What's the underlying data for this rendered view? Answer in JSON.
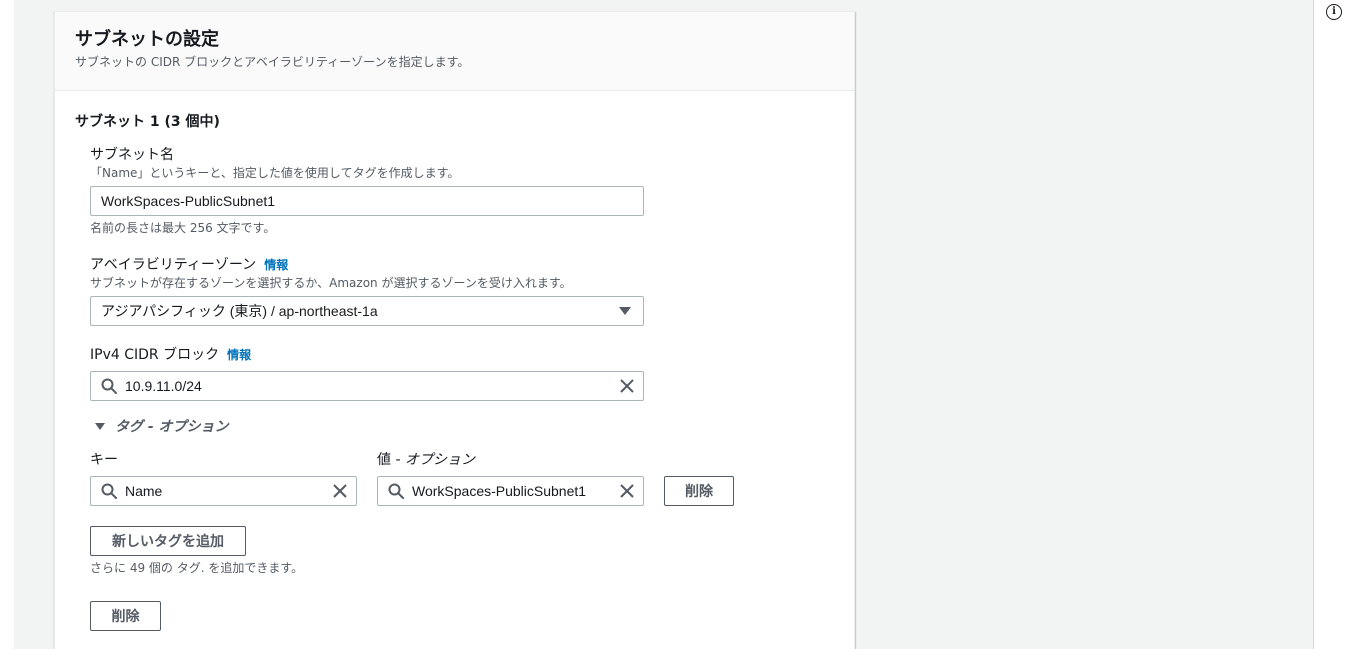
{
  "help_icon": "info-icon",
  "section": {
    "title": "サブネットの設定",
    "description": "サブネットの CIDR ブロックとアベイラビリティーゾーンを指定します。"
  },
  "subnet": {
    "heading": "サブネット 1 (3 個中)",
    "name_field": {
      "label": "サブネット名",
      "description": "「Name」というキーと、指定した値を使用してタグを作成します。",
      "value": "WorkSpaces-PublicSubnet1",
      "constraint": "名前の長さは最大 256 文字です。"
    },
    "az_field": {
      "label": "アベイラビリティーゾーン",
      "info": "情報",
      "description": "サブネットが存在するゾーンを選択するか、Amazon が選択するゾーンを受け入れます。",
      "selected": "アジアパシフィック (東京) / ap-northeast-1a"
    },
    "cidr_field": {
      "label": "IPv4 CIDR ブロック",
      "info": "情報",
      "value": "10.9.11.0/24"
    },
    "tags": {
      "toggle_label": "タグ - オプション",
      "key_label": "キー",
      "value_label_main": "値",
      "value_label_optional": " - オプション",
      "rows": [
        {
          "key": "Name",
          "value": "WorkSpaces-PublicSubnet1",
          "remove_label": "削除"
        }
      ],
      "add_button": "新しいタグを追加",
      "remaining_note": "さらに 49 個の タグ. を追加できます。"
    },
    "remove_subnet_button": "削除"
  }
}
